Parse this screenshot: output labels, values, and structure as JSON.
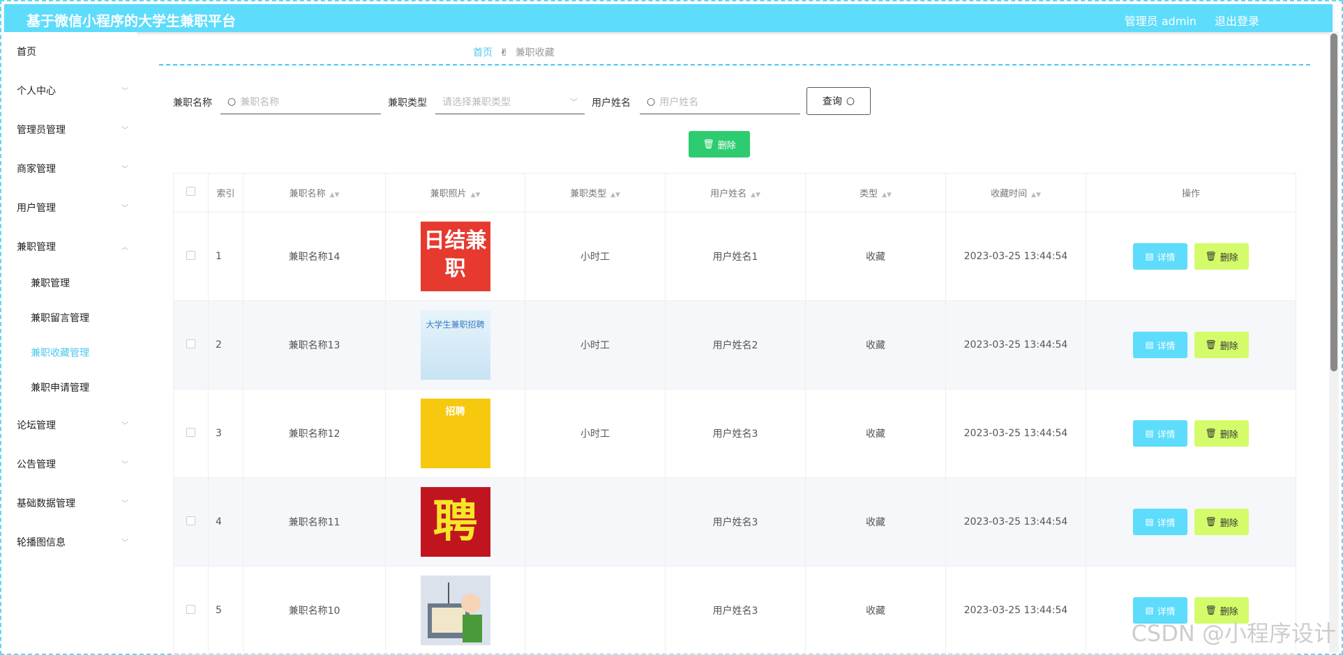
{
  "header": {
    "title": "基于微信小程序的大学生兼职平台",
    "admin": "管理员 admin",
    "logout": "退出登录",
    "bg_color": "#5ddcfb"
  },
  "sidebar": {
    "items": [
      {
        "label": "首页"
      },
      {
        "label": "个人中心"
      },
      {
        "label": "管理员管理"
      },
      {
        "label": "商家管理"
      },
      {
        "label": "用户管理"
      },
      {
        "label": "兼职管理"
      },
      {
        "label": "论坛管理"
      },
      {
        "label": "公告管理"
      },
      {
        "label": "基础数据管理"
      },
      {
        "label": "轮播图信息"
      }
    ],
    "sub_items": [
      {
        "label": "兼职管理"
      },
      {
        "label": "兼职留言管理"
      },
      {
        "label": "兼职收藏管理"
      },
      {
        "label": "兼职申请管理"
      }
    ],
    "active_color": "#4cc9ef"
  },
  "breadcrumb": {
    "home": "首页",
    "current": "兼职收藏"
  },
  "filters": {
    "name_label": "兼职名称",
    "name_placeholder": "兼职名称",
    "type_label": "兼职类型",
    "type_placeholder": "请选择兼职类型",
    "user_label": "用户姓名",
    "user_placeholder": "用户姓名",
    "query_label": "查询"
  },
  "bulk_delete_label": "删除",
  "table": {
    "headers": [
      "索引",
      "兼职名称",
      "兼职照片",
      "兼职类型",
      "用户姓名",
      "类型",
      "收藏时间",
      "操作"
    ],
    "rows": [
      {
        "index": "1",
        "name": "兼职名称14",
        "type": "小时工",
        "user": "用户姓名1",
        "kind": "收藏",
        "time": "2023-03-25 13:44:54",
        "photo_text": "日结兼职"
      },
      {
        "index": "2",
        "name": "兼职名称13",
        "type": "小时工",
        "user": "用户姓名2",
        "kind": "收藏",
        "time": "2023-03-25 13:44:54",
        "photo_text": "大学生兼职招聘"
      },
      {
        "index": "3",
        "name": "兼职名称12",
        "type": "小时工",
        "user": "用户姓名3",
        "kind": "收藏",
        "time": "2023-03-25 13:44:54",
        "photo_text": "招聘"
      },
      {
        "index": "4",
        "name": "兼职名称11",
        "type": "",
        "user": "用户姓名3",
        "kind": "收藏",
        "time": "2023-03-25 13:44:54",
        "photo_text": "聘"
      },
      {
        "index": "5",
        "name": "兼职名称10",
        "type": "",
        "user": "用户姓名3",
        "kind": "收藏",
        "time": "2023-03-25 13:44:54",
        "photo_text": ""
      }
    ],
    "detail_label": "详情",
    "delete_label": "删除"
  },
  "watermark": "CSDN @小程序设计"
}
